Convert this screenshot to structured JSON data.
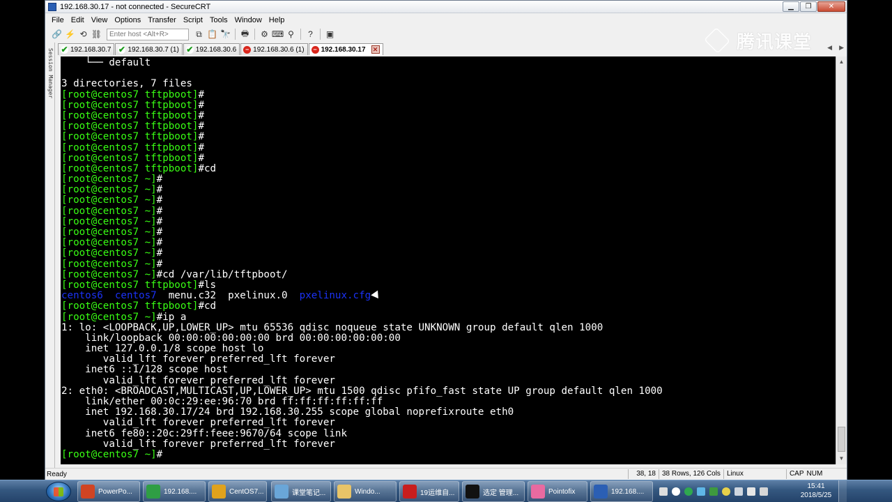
{
  "window": {
    "title": "192.168.30.17 - not connected - SecureCRT"
  },
  "menu": [
    "File",
    "Edit",
    "View",
    "Options",
    "Transfer",
    "Script",
    "Tools",
    "Window",
    "Help"
  ],
  "toolbar": {
    "host_placeholder": "Enter host <Alt+R>"
  },
  "watermark": {
    "text": "腾讯课堂"
  },
  "sidebar": {
    "label": "Session Manager"
  },
  "tabs": [
    {
      "label": "192.168.30.7",
      "status": "connected"
    },
    {
      "label": "192.168.30.7 (1)",
      "status": "connected"
    },
    {
      "label": "192.168.30.6",
      "status": "connected"
    },
    {
      "label": "192.168.30.6 (1)",
      "status": "disconnected"
    },
    {
      "label": "192.168.30.17",
      "status": "disconnected",
      "active": true
    }
  ],
  "terminal": {
    "lines": [
      {
        "segments": [
          {
            "t": "    └── default",
            "c": "w"
          }
        ]
      },
      {
        "segments": [
          {
            "t": "",
            "c": "w"
          }
        ]
      },
      {
        "segments": [
          {
            "t": "3 directories, 7 files",
            "c": "w"
          }
        ]
      },
      {
        "segments": [
          {
            "t": "[root@centos7 tftpboot]",
            "c": "g"
          },
          {
            "t": "#",
            "c": "w"
          }
        ]
      },
      {
        "segments": [
          {
            "t": "[root@centos7 tftpboot]",
            "c": "g"
          },
          {
            "t": "#",
            "c": "w"
          }
        ]
      },
      {
        "segments": [
          {
            "t": "[root@centos7 tftpboot]",
            "c": "g"
          },
          {
            "t": "#",
            "c": "w"
          }
        ]
      },
      {
        "segments": [
          {
            "t": "[root@centos7 tftpboot]",
            "c": "g"
          },
          {
            "t": "#",
            "c": "w"
          }
        ]
      },
      {
        "segments": [
          {
            "t": "[root@centos7 tftpboot]",
            "c": "g"
          },
          {
            "t": "#",
            "c": "w"
          }
        ]
      },
      {
        "segments": [
          {
            "t": "[root@centos7 tftpboot]",
            "c": "g"
          },
          {
            "t": "#",
            "c": "w"
          }
        ]
      },
      {
        "segments": [
          {
            "t": "[root@centos7 tftpboot]",
            "c": "g"
          },
          {
            "t": "#",
            "c": "w"
          }
        ]
      },
      {
        "segments": [
          {
            "t": "[root@centos7 tftpboot]",
            "c": "g"
          },
          {
            "t": "#cd",
            "c": "w"
          }
        ]
      },
      {
        "segments": [
          {
            "t": "[root@centos7 ~]",
            "c": "g"
          },
          {
            "t": "#",
            "c": "w"
          }
        ]
      },
      {
        "segments": [
          {
            "t": "[root@centos7 ~]",
            "c": "g"
          },
          {
            "t": "#",
            "c": "w"
          }
        ]
      },
      {
        "segments": [
          {
            "t": "[root@centos7 ~]",
            "c": "g"
          },
          {
            "t": "#",
            "c": "w"
          }
        ]
      },
      {
        "segments": [
          {
            "t": "[root@centos7 ~]",
            "c": "g"
          },
          {
            "t": "#",
            "c": "w"
          }
        ]
      },
      {
        "segments": [
          {
            "t": "[root@centos7 ~]",
            "c": "g"
          },
          {
            "t": "#",
            "c": "w"
          }
        ]
      },
      {
        "segments": [
          {
            "t": "[root@centos7 ~]",
            "c": "g"
          },
          {
            "t": "#",
            "c": "w"
          }
        ]
      },
      {
        "segments": [
          {
            "t": "[root@centos7 ~]",
            "c": "g"
          },
          {
            "t": "#",
            "c": "w"
          }
        ]
      },
      {
        "segments": [
          {
            "t": "[root@centos7 ~]",
            "c": "g"
          },
          {
            "t": "#",
            "c": "w"
          }
        ]
      },
      {
        "segments": [
          {
            "t": "[root@centos7 ~]",
            "c": "g"
          },
          {
            "t": "#",
            "c": "w"
          }
        ]
      },
      {
        "segments": [
          {
            "t": "[root@centos7 ~]",
            "c": "g"
          },
          {
            "t": "#cd /var/lib/tftpboot/",
            "c": "w"
          }
        ]
      },
      {
        "segments": [
          {
            "t": "[root@centos7 tftpboot]",
            "c": "g"
          },
          {
            "t": "#ls",
            "c": "w"
          }
        ]
      },
      {
        "segments": [
          {
            "t": "centos6  centos7",
            "c": "b"
          },
          {
            "t": "  menu.c32  pxelinux.0  ",
            "c": "w"
          },
          {
            "t": "pxelinux.cfg",
            "c": "b"
          }
        ],
        "cursor": true
      },
      {
        "segments": [
          {
            "t": "[root@centos7 tftpboot]",
            "c": "g"
          },
          {
            "t": "#cd",
            "c": "w"
          }
        ]
      },
      {
        "segments": [
          {
            "t": "[root@centos7 ~]",
            "c": "g"
          },
          {
            "t": "#ip a",
            "c": "w"
          }
        ]
      },
      {
        "segments": [
          {
            "t": "1: lo: <LOOPBACK,UP,LOWER_UP> mtu 65536 qdisc noqueue state UNKNOWN group default qlen 1000",
            "c": "w"
          }
        ]
      },
      {
        "segments": [
          {
            "t": "    link/loopback 00:00:00:00:00:00 brd 00:00:00:00:00:00",
            "c": "w"
          }
        ]
      },
      {
        "segments": [
          {
            "t": "    inet 127.0.0.1/8 scope host lo",
            "c": "w"
          }
        ]
      },
      {
        "segments": [
          {
            "t": "       valid_lft forever preferred_lft forever",
            "c": "w"
          }
        ]
      },
      {
        "segments": [
          {
            "t": "    inet6 ::1/128 scope host",
            "c": "w"
          }
        ]
      },
      {
        "segments": [
          {
            "t": "       valid_lft forever preferred_lft forever",
            "c": "w"
          }
        ]
      },
      {
        "segments": [
          {
            "t": "2: eth0: <BROADCAST,MULTICAST,UP,LOWER_UP> mtu 1500 qdisc pfifo_fast state UP group default qlen 1000",
            "c": "w"
          }
        ]
      },
      {
        "segments": [
          {
            "t": "    link/ether 00:0c:29:ee:96:70 brd ff:ff:ff:ff:ff:ff",
            "c": "w"
          }
        ]
      },
      {
        "segments": [
          {
            "t": "    inet 192.168.30.17/24 brd 192.168.30.255 scope global noprefixroute eth0",
            "c": "w"
          }
        ]
      },
      {
        "segments": [
          {
            "t": "       valid_lft forever preferred_lft forever",
            "c": "w"
          }
        ]
      },
      {
        "segments": [
          {
            "t": "    inet6 fe80::20c:29ff:feee:9670/64 scope link",
            "c": "w"
          }
        ]
      },
      {
        "segments": [
          {
            "t": "       valid_lft forever preferred_lft forever",
            "c": "w"
          }
        ]
      },
      {
        "segments": [
          {
            "t": "[root@centos7 ~]",
            "c": "g"
          },
          {
            "t": "#",
            "c": "w"
          }
        ]
      }
    ]
  },
  "status": {
    "ready": "Ready",
    "position": "38, 18",
    "size": "38 Rows, 126 Cols",
    "os": "Linux",
    "cap": "CAP",
    "num": "NUM"
  },
  "taskbar": {
    "items": [
      {
        "label": "PowerPo...",
        "color": "#d04423"
      },
      {
        "label": "192.168....",
        "color": "#2f9e44"
      },
      {
        "label": "CentOS7...",
        "color": "#e0a21c"
      },
      {
        "label": "课堂笔记...",
        "color": "#6aa6d8"
      },
      {
        "label": "Windo...",
        "color": "#e8c468"
      },
      {
        "label": "19运维自...",
        "color": "#c81e1e"
      },
      {
        "label": "选定 管理...",
        "color": "#111111"
      },
      {
        "label": "Pointofix",
        "color": "#e86aa0"
      },
      {
        "label": "192.168....",
        "color": "#2b5fb4"
      }
    ],
    "time": "15:41",
    "date": "2018/5/25"
  }
}
